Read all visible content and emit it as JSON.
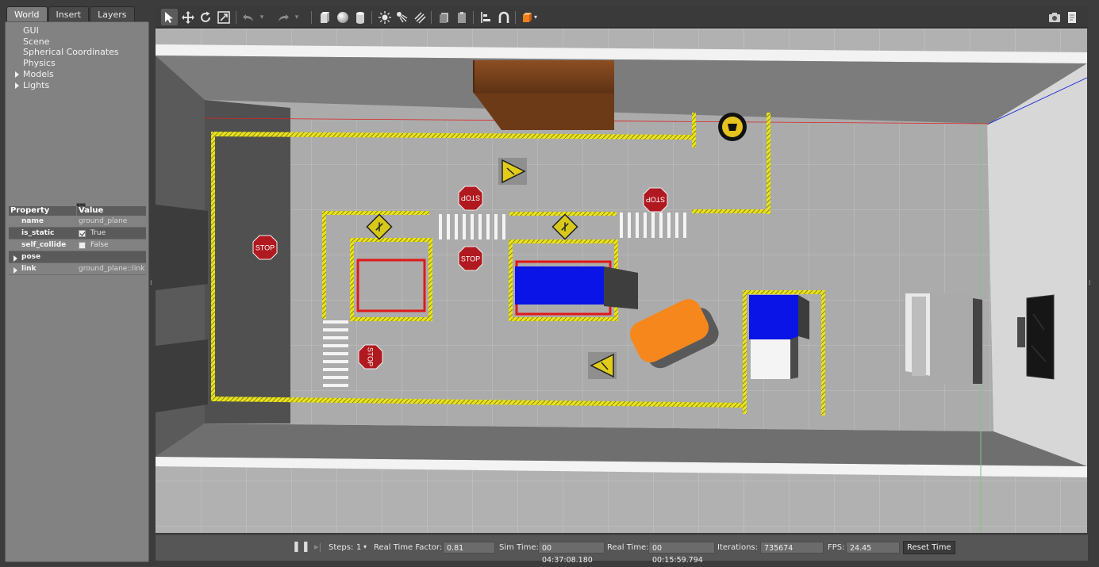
{
  "left_panel": {
    "tabs": [
      "World",
      "Insert",
      "Layers"
    ],
    "active_tab": "World",
    "tree": [
      {
        "label": "GUI",
        "expandable": false
      },
      {
        "label": "Scene",
        "expandable": false
      },
      {
        "label": "Spherical Coordinates",
        "expandable": false
      },
      {
        "label": "Physics",
        "expandable": false
      },
      {
        "label": "Models",
        "expandable": true
      },
      {
        "label": "Lights",
        "expandable": true
      }
    ],
    "property_header": {
      "property": "Property",
      "value": "Value"
    },
    "properties": [
      {
        "key": "name",
        "value": "ground_plane"
      },
      {
        "key": "is_static",
        "value": "True",
        "checked": true
      },
      {
        "key": "self_collide",
        "value": "False",
        "checked": false
      },
      {
        "key": "pose",
        "value": ""
      },
      {
        "key": "link",
        "value": "ground_plane::link"
      }
    ]
  },
  "toolbar": {
    "icons": [
      "select-mode-icon",
      "translate-mode-icon",
      "rotate-mode-icon",
      "scale-mode-icon",
      "undo-icon",
      "redo-icon",
      "box-shape-icon",
      "sphere-shape-icon",
      "cylinder-shape-icon",
      "point-light-icon",
      "spot-light-icon",
      "directional-light-icon",
      "copy-icon",
      "paste-icon",
      "align-icon",
      "snap-icon",
      "view-angle-icon",
      "screenshot-icon",
      "record-log-icon"
    ]
  },
  "viewport": {
    "signs": {
      "stop": "STOP"
    }
  },
  "bottom_bar": {
    "steps_label": "Steps:",
    "steps_value": "1",
    "real_time_factor_label": "Real Time Factor:",
    "real_time_factor_value": "0.81",
    "sim_time_label": "Sim Time:",
    "sim_time_value": "00 04:37:08.180",
    "real_time_label": "Real Time:",
    "real_time_value": "00 00:15:59.794",
    "iterations_label": "Iterations:",
    "iterations_value": "735674",
    "fps_label": "FPS:",
    "fps_value": "24.45",
    "reset_time_label": "Reset Time"
  },
  "colors": {
    "lane_yellow": "#e8e21a",
    "parking_red": "#e01818",
    "box_blue": "#0a14e6",
    "box_orange": "#f5871c",
    "stop_red": "#b0191f",
    "wall_white": "#f2f2f2",
    "floor": "#a9a9a9"
  }
}
